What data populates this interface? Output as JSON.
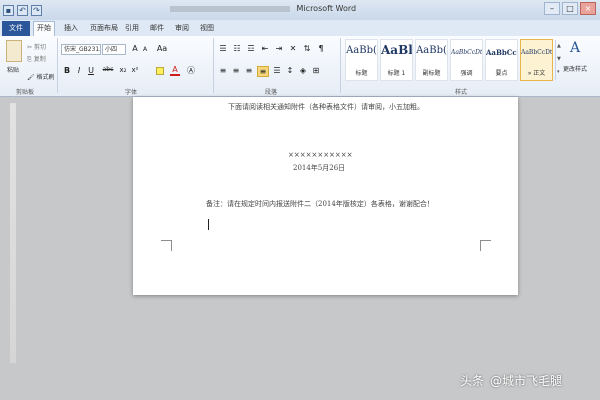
{
  "titlebar": {
    "title": "Microsoft Word",
    "controls": {
      "minimize": "–",
      "maximize": "□",
      "close": "×"
    }
  },
  "quick_access": [
    {
      "name": "save-icon",
      "glyph": "▪"
    },
    {
      "name": "undo-icon",
      "glyph": "↶"
    },
    {
      "name": "redo-icon",
      "glyph": "↷"
    }
  ],
  "ribbon_tabs": {
    "file": "文件",
    "home": "开始",
    "insert": "插入",
    "page_layout": "页面布局",
    "references": "引用",
    "mailings": "邮件",
    "review": "审阅",
    "view": "视图"
  },
  "clipboard": {
    "paste": "粘贴",
    "cut": "剪切",
    "copy": "复制",
    "format_painter": "格式刷",
    "group_label": "剪贴板"
  },
  "font": {
    "font_name": "仿宋_GB2312",
    "font_size": "小四",
    "bold": "B",
    "italic": "I",
    "underline": "U",
    "strike": "abc",
    "subscript": "x₂",
    "superscript": "x²",
    "grow": "A",
    "shrink": "A",
    "change_case": "Aa",
    "font_color": "A",
    "group_label": "字体"
  },
  "paragraph": {
    "group_label": "段落"
  },
  "styles": {
    "group_label": "样式",
    "items": [
      {
        "sample": "AaBb(",
        "name": "标题",
        "size": "10px"
      },
      {
        "sample": "AaBl",
        "name": "标题 1",
        "size": "12px"
      },
      {
        "sample": "AaBb(",
        "name": "副标题",
        "size": "10px"
      },
      {
        "sample": "AaBbCcDt",
        "name": "强调",
        "size": "6px"
      },
      {
        "sample": "AaBbCcD",
        "name": "要点",
        "size": "7px"
      },
      {
        "sample": "AaBbCcDt",
        "name": "» 正文",
        "size": "6px"
      }
    ],
    "change_styles": "更改样式"
  },
  "document": {
    "line1": "下面请阅读相关通知附件（各种表格文件）请审阅，小五加粗。",
    "line2": "×××××××××××",
    "line3": "2014年5月26日",
    "line4": "备注：请在规定时间内报送附件二（2014年版核定）各表格，谢谢配合！"
  },
  "watermark": {
    "source": "头条",
    "author": "@城市飞毛腿"
  }
}
